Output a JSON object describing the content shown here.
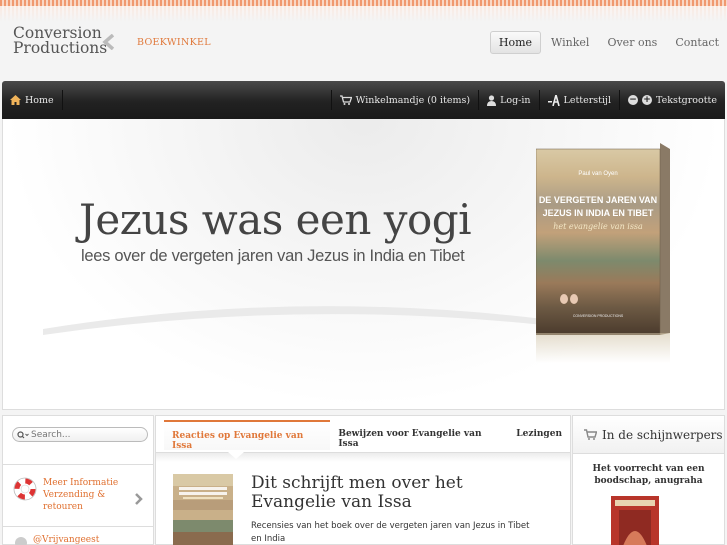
{
  "header": {
    "logo_line1": "Conversion",
    "logo_line2": "Productions",
    "breadcrumb": "BOEKWINKEL",
    "nav": [
      {
        "label": "Home",
        "active": true
      },
      {
        "label": "Winkel",
        "active": false
      },
      {
        "label": "Over ons",
        "active": false
      },
      {
        "label": "Contact",
        "active": false
      }
    ]
  },
  "toolbar": {
    "home_label": "Home",
    "cart_label": "Winkelmandje (0 items)",
    "login_label": "Log-in",
    "font_style_label": "Letterstijl",
    "text_size_label": "Tekstgrootte",
    "icons": [
      "home-icon",
      "cart-icon",
      "user-icon",
      "font-icon",
      "minus-icon",
      "plus-icon"
    ]
  },
  "hero": {
    "title": "Jezus was een yogi",
    "subtitle": "lees over de vergeten jaren van Jezus in India en Tibet",
    "book": {
      "author": "Paul van Oyen",
      "title_line1": "DE VERGETEN JAREN VAN",
      "title_line2": "JEZUS IN INDIA EN TIBET",
      "subtitle": "het evangelie van issa",
      "publisher": "CONVERSION PRODUCTIONS"
    }
  },
  "sidebar_left": {
    "search_placeholder": "Search...",
    "info_title": "Meer Informatie",
    "info_line2": "Verzending &",
    "info_line3": "retouren",
    "social_text": "@Vrijvangeest"
  },
  "center": {
    "tabs": [
      {
        "label": "Reacties op Evangelie van Issa",
        "active": true
      },
      {
        "label": "Bewijzen voor Evangelie van Issa",
        "active": false
      },
      {
        "label": "Lezingen",
        "active": false
      }
    ],
    "article_title": "Dit schrijft men over het Evangelie van Issa",
    "article_desc": "Recensies van het boek over de vergeten jaren van Jezus in Tibet en India"
  },
  "sidebar_right": {
    "heading": "In de schijnwerpers",
    "spotlight_title": "Het voorrecht van een boodschap, anugraha"
  },
  "colors": {
    "accent": "#e0783a",
    "toolbar_dark": "#222222",
    "text": "#333333"
  }
}
